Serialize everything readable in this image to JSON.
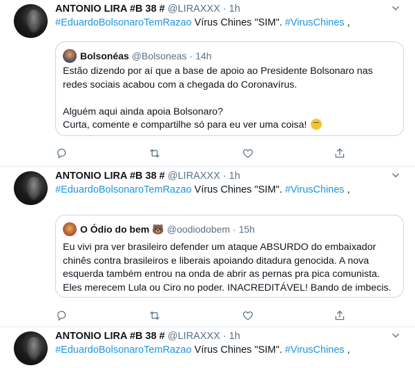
{
  "colors": {
    "link": "#1b95e0",
    "muted": "#5b7083",
    "border": "#ccd6dd"
  },
  "tweets": [
    {
      "author_name": "ANTONIO LIRA #B 38 #",
      "handle": "@LIRAXXX",
      "dot": "·",
      "time": "1h",
      "hashtag1": "#EduardoBolsonaroTemRazao",
      "text_mid": " Vírus Chines \"SIM\". ",
      "hashtag2": "#VirusChines",
      "text_end": " ,",
      "quote": {
        "name": "Bolsonéas",
        "handle": "@Bolsoneas",
        "dot": "·",
        "time": "14h",
        "lines": [
          "Estão dizendo por aí que a base de apoio ao Presidente Bolsonaro nas",
          "redes sociais acabou com a chegada do Coronavírus.",
          "",
          "Alguém aqui ainda apoia Bolsonaro?",
          "Curta, comente e compartilhe só para eu ver uma coisa!"
        ]
      }
    },
    {
      "author_name": "ANTONIO LIRA #B 38 #",
      "handle": "@LIRAXXX",
      "dot": "·",
      "time": "1h",
      "hashtag1": "#EduardoBolsonaroTemRazao",
      "text_mid": " Vírus Chines \"SIM\". ",
      "hashtag2": "#VirusChines",
      "text_end": " ,",
      "quote": {
        "name": "O Ódio do bem",
        "handle": "@oodiodobem",
        "dot": "·",
        "time": "15h",
        "lines": [
          "Eu vivi pra ver brasileiro defender um ataque ABSURDO do embaixador",
          "chinês contra brasileiros e liberais apoiando ditadura genocida. A nova",
          "esquerda também entrou na onda de abrir as pernas pra pica comunista.",
          "Eles merecem Lula ou Ciro no poder. INACREDITÁVEL! Bando de imbecis."
        ]
      }
    },
    {
      "author_name": "ANTONIO LIRA #B 38 #",
      "handle": "@LIRAXXX",
      "dot": "·",
      "time": "1h",
      "hashtag1": "#EduardoBolsonaroTemRazao",
      "text_mid": " Vírus Chines \"SIM\". ",
      "hashtag2": "#VirusChines",
      "text_end": " ,"
    }
  ],
  "icons": {
    "reply": "reply-icon",
    "retweet": "retweet-icon",
    "like": "like-icon",
    "share": "share-icon",
    "caret": "chevron-down-icon",
    "thinking": "thinking-face-emoji",
    "bear": "bear-face-emoji"
  }
}
